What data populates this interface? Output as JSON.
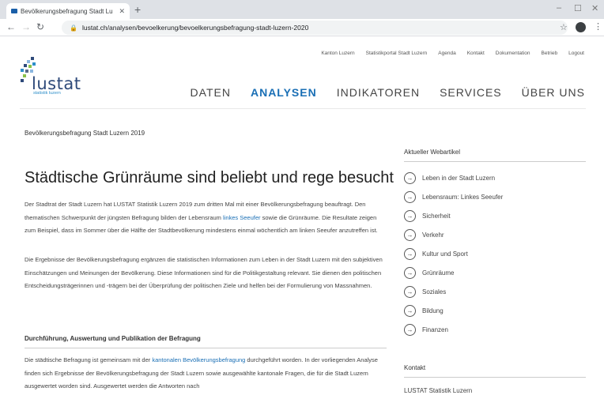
{
  "browser": {
    "tab_title": "Bevölkerungsbefragung Stadt Lu",
    "url": "lustat.ch/analysen/bevoelkerung/bevoelkerungsbefragung-stadt-luzern-2020"
  },
  "site": {
    "logo_word": "lustat",
    "logo_sub": "statistik luzern",
    "top_links": [
      "Kanton Luzern",
      "Statistikportal Stadt Luzern",
      "Agenda",
      "Kontakt",
      "Dokumentation",
      "Betrieb",
      "Logout"
    ],
    "main_nav": [
      "DATEN",
      "ANALYSEN",
      "INDIKATOREN",
      "SERVICES",
      "ÜBER UNS"
    ]
  },
  "main": {
    "breadcrumb": "Bevölkerungsbefragung Stadt Luzern 2019",
    "title": "Städtische Grünräume sind beliebt und rege besucht",
    "p1_a": "Der Stadtrat der Stadt Luzern hat LUSTAT Statistik Luzern 2019 zum dritten Mal mit einer Bevölkerungsbefragung beauftragt. Den thematischen Schwerpunkt der jüngsten Befragung bilden der Lebensraum ",
    "p1_link": "linkes Seeufer",
    "p1_b": " sowie die Grünräume. Die Resultate zeigen zum Beispiel, dass im Sommer über die Hälfte der Stadtbevölkerung mindestens einmal wöchentlich am linken Seeufer anzutreffen ist.",
    "p2": "Die Ergebnisse der Bevölkerungsbefragung ergänzen die statistischen Informationen zum Leben in der Stadt Luzern mit den subjektiven Einschätzungen und Meinungen der Bevölkerung. Diese Informationen sind für die Politikgestaltung relevant. Sie dienen den politischen Entscheidungsträgerinnen und -trägern bei der Überprüfung der politischen Ziele und helfen bei der Formulierung von Massnahmen.",
    "section_title": "Durchführung, Auswertung und Publikation der Befragung",
    "p3_a": "Die städtische Befragung ist gemeinsam mit der ",
    "p3_link": "kantonalen Bevölkerungsbefragung",
    "p3_b": " durchgeführt worden. In der vorliegenden Analyse finden sich Ergebnisse der Bevölkerungsbefragung der Stadt Luzern sowie ausgewählte kantonale Fragen, die für die Stadt Luzern ausgewertet worden sind. Ausgewertet werden die Antworten nach"
  },
  "sidebar": {
    "heading": "Aktueller Webartikel",
    "items": [
      "Leben in der Stadt Luzern",
      "Lebensraum: Linkes Seeufer",
      "Sicherheit",
      "Verkehr",
      "Kultur und Sport",
      "Grünräume",
      "Soziales",
      "Bildung",
      "Finanzen"
    ],
    "contact_heading": "Kontakt",
    "contact_name": "LUSTAT Statistik Luzern"
  }
}
